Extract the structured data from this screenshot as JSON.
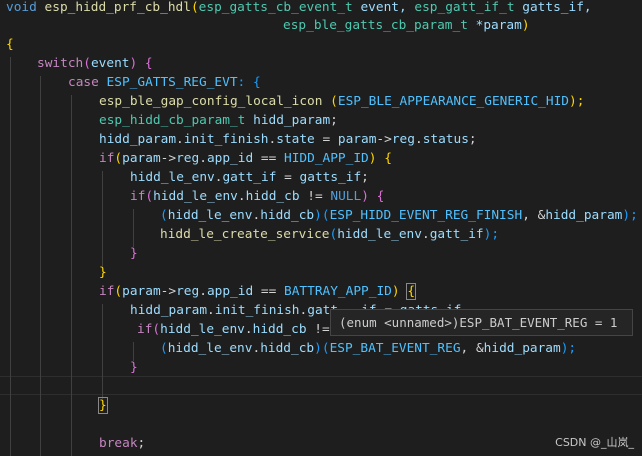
{
  "code": {
    "l1": {
      "t0": "void",
      "t1": " ",
      "t2": "esp_hidd_prf_cb_hdl",
      "t3": "(",
      "t4": "esp_gatts_cb_event_t",
      "t5": " event, ",
      "t6": "esp_gatt_if_t",
      "t7": " gatts_if,"
    },
    "l2": {
      "t0": "esp_ble_gatts_cb_param_t",
      "t1": " *param",
      "t2": ")"
    },
    "l3": {
      "t0": "{"
    },
    "l4": {
      "t0": "switch",
      "t1": "(",
      "t2": "event",
      "t3": ")",
      "t4": " ",
      "t5": "{"
    },
    "l5": {
      "t0": "case",
      "t1": " ",
      "t2": "ESP_GATTS_REG_EVT",
      "t3": ": {"
    },
    "l6": {
      "t0": "esp_ble_gap_config_local_icon",
      "t1": " (",
      "t2": "ESP_BLE_APPEARANCE_GENERIC_HID",
      "t3": ");"
    },
    "l7": {
      "t0": "esp_hidd_cb_param_t",
      "t1": " ",
      "t2": "hidd_param",
      "t3": ";"
    },
    "l8": {
      "t0": "hidd_param",
      "t1": ".",
      "t2": "init_finish",
      "t3": ".",
      "t4": "state",
      "t5": " = ",
      "t6": "param",
      "t7": "->",
      "t8": "reg",
      "t9": ".",
      "t10": "status",
      "t11": ";"
    },
    "l9": {
      "t0": "if",
      "t1": "(",
      "t2": "param",
      "t3": "->",
      "t4": "reg",
      "t5": ".",
      "t6": "app_id",
      "t7": " == ",
      "t8": "HIDD_APP_ID",
      "t9": ")",
      "t10": " ",
      "t11": "{"
    },
    "l10": {
      "t0": "hidd_le_env",
      "t1": ".",
      "t2": "gatt_if",
      "t3": " = ",
      "t4": "gatts_if",
      "t5": ";"
    },
    "l11": {
      "t0": "if",
      "t1": "(",
      "t2": "hidd_le_env",
      "t3": ".",
      "t4": "hidd_cb",
      "t5": " != ",
      "t6": "NULL",
      "t7": ")",
      "t8": " ",
      "t9": "{"
    },
    "l12": {
      "t0": "(",
      "t1": "hidd_le_env",
      "t2": ".",
      "t3": "hidd_cb",
      "t4": ")",
      "t5": "(",
      "t6": "ESP_HIDD_EVENT_REG_FINISH",
      "t7": ", &",
      "t8": "hidd_param",
      "t9": ");"
    },
    "l13": {
      "t0": "hidd_le_create_service",
      "t1": "(",
      "t2": "hidd_le_env",
      "t3": ".",
      "t4": "gatt_if",
      "t5": ");"
    },
    "l14": {
      "t0": "}"
    },
    "l15": {
      "t0": "}"
    },
    "l16": {
      "t0": "if",
      "t1": "(",
      "t2": "param",
      "t3": "->",
      "t4": "reg",
      "t5": ".",
      "t6": "app_id",
      "t7": " == ",
      "t8": "BATTRAY_APP_ID",
      "t9": ")",
      "t10": " ",
      "t11": "{"
    },
    "l17": {
      "t0": "hidd_param",
      "t1": ".",
      "t2": "init_finish",
      "t3": ".",
      "t4": "gatt",
      "t5": "   ",
      "t6": "if",
      "t7": " = ",
      "t8": "gatts_if"
    },
    "l18": {
      "t0": "if",
      "t1": "(",
      "t2": "hidd_le_env",
      "t3": ".",
      "t4": "hidd_cb",
      "t5": " !="
    },
    "l19": {
      "t0": "(",
      "t1": "hidd_le_env",
      "t2": ".",
      "t3": "hidd_cb",
      "t4": ")",
      "t5": "(",
      "t6": "ESP_BAT_EVENT_REG",
      "t7": ", &",
      "t8": "hidd_param",
      "t9": ");"
    },
    "l20": {
      "t0": "}"
    },
    "l22": {
      "t0": "}"
    },
    "l24": {
      "t0": "break",
      "t1": ";"
    }
  },
  "tooltip": {
    "text": "(enum <unnamed>)ESP_BAT_EVENT_REG = 1"
  },
  "watermark": {
    "text": "CSDN @_山岚_"
  }
}
